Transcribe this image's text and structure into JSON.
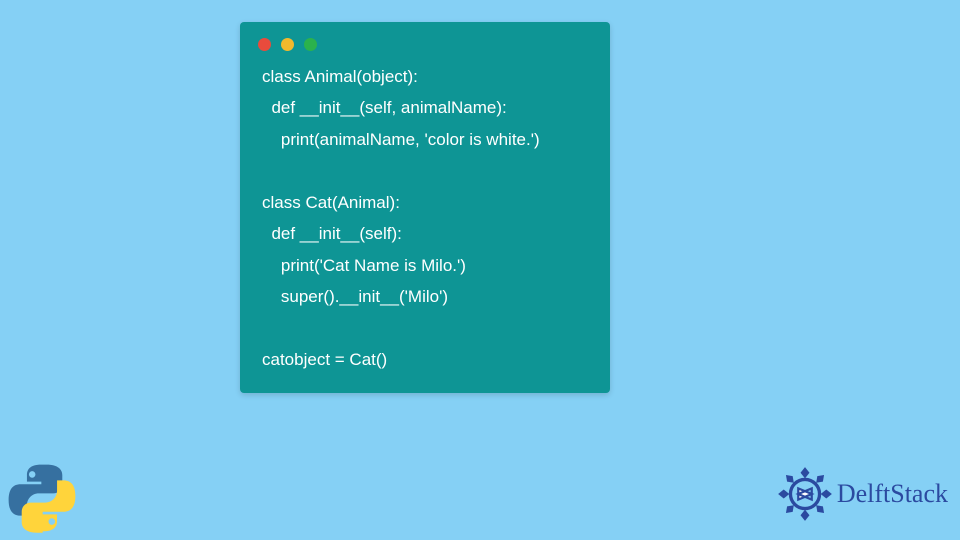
{
  "window": {
    "dots": [
      "red",
      "yellow",
      "green"
    ]
  },
  "code": {
    "text": "class Animal(object):\n  def __init__(self, animalName):\n    print(animalName, 'color is white.')\n\nclass Cat(Animal):\n  def __init__(self):\n    print('Cat Name is Milo.')\n    super().__init__('Milo')\n\ncatobject = Cat()"
  },
  "branding": {
    "name": "DelftStack"
  },
  "colors": {
    "page_bg": "#85d0f5",
    "card_bg": "#0e9595",
    "code_fg": "#ffffff",
    "brand_text": "#2b4aa0"
  }
}
